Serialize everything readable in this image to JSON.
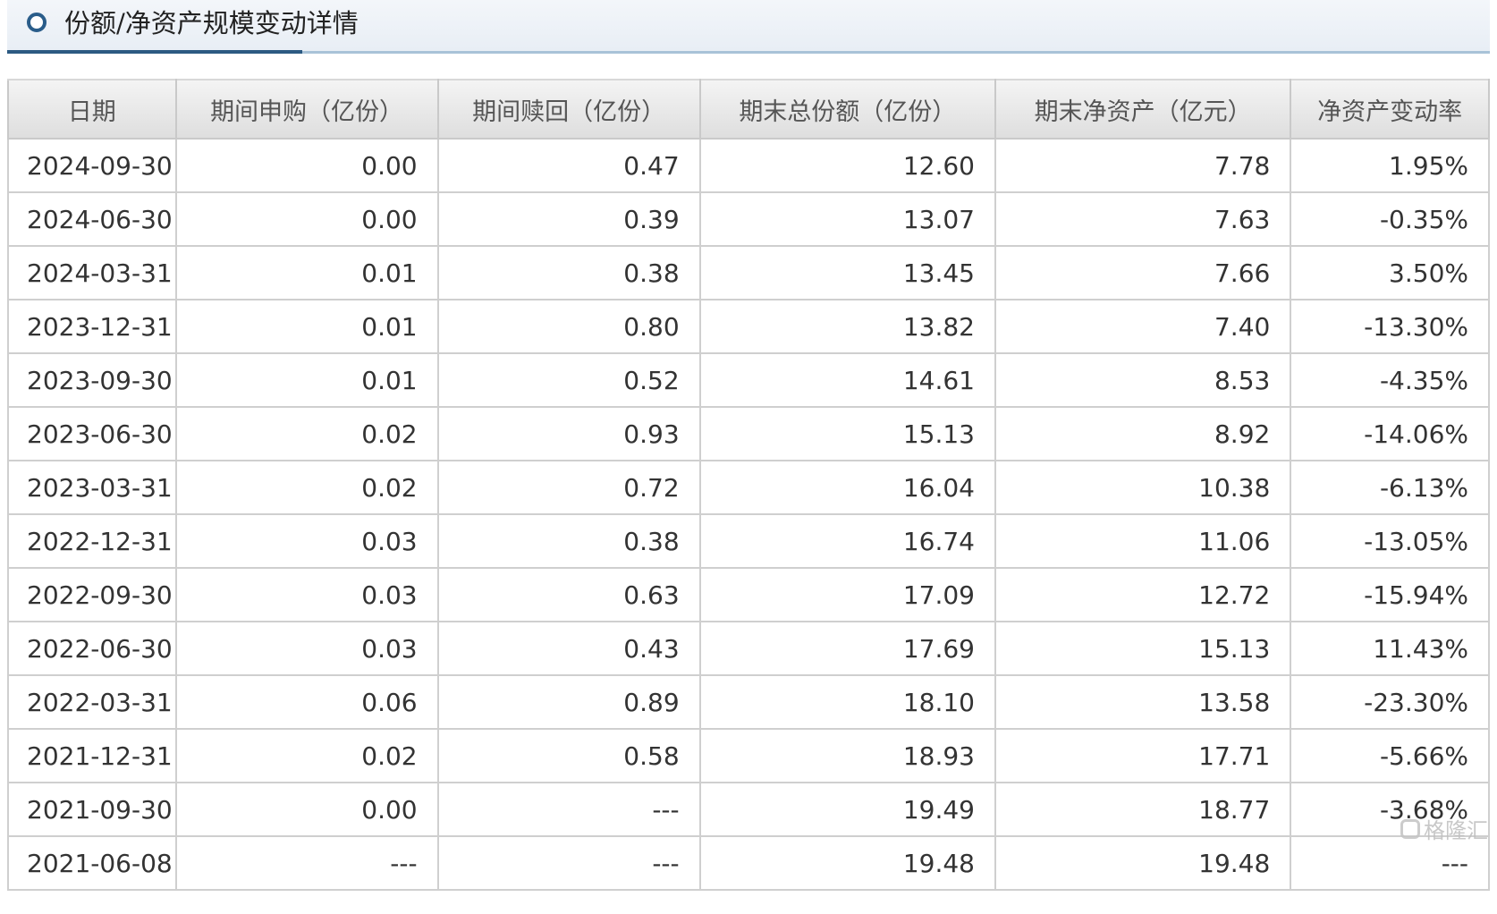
{
  "title": "份额/净资产规模变动详情",
  "colors": {
    "title_icon": "#2a5d8a",
    "title_accent": "#2c5a82",
    "header_bg": "#e6e6e6",
    "text": "#333333"
  },
  "table": {
    "headers": [
      "日期",
      "期间申购（亿份）",
      "期间赎回（亿份）",
      "期末总份额（亿份）",
      "期末净资产（亿元）",
      "净资产变动率"
    ],
    "rows": [
      [
        "2024-09-30",
        "0.00",
        "0.47",
        "12.60",
        "7.78",
        "1.95%"
      ],
      [
        "2024-06-30",
        "0.00",
        "0.39",
        "13.07",
        "7.63",
        "-0.35%"
      ],
      [
        "2024-03-31",
        "0.01",
        "0.38",
        "13.45",
        "7.66",
        "3.50%"
      ],
      [
        "2023-12-31",
        "0.01",
        "0.80",
        "13.82",
        "7.40",
        "-13.30%"
      ],
      [
        "2023-09-30",
        "0.01",
        "0.52",
        "14.61",
        "8.53",
        "-4.35%"
      ],
      [
        "2023-06-30",
        "0.02",
        "0.93",
        "15.13",
        "8.92",
        "-14.06%"
      ],
      [
        "2023-03-31",
        "0.02",
        "0.72",
        "16.04",
        "10.38",
        "-6.13%"
      ],
      [
        "2022-12-31",
        "0.03",
        "0.38",
        "16.74",
        "11.06",
        "-13.05%"
      ],
      [
        "2022-09-30",
        "0.03",
        "0.63",
        "17.09",
        "12.72",
        "-15.94%"
      ],
      [
        "2022-06-30",
        "0.03",
        "0.43",
        "17.69",
        "15.13",
        "11.43%"
      ],
      [
        "2022-03-31",
        "0.06",
        "0.89",
        "18.10",
        "13.58",
        "-23.30%"
      ],
      [
        "2021-12-31",
        "0.02",
        "0.58",
        "18.93",
        "17.71",
        "-5.66%"
      ],
      [
        "2021-09-30",
        "0.00",
        "---",
        "19.49",
        "18.77",
        "-3.68%"
      ],
      [
        "2021-06-08",
        "---",
        "---",
        "19.48",
        "19.48",
        "---"
      ]
    ]
  },
  "watermark": "格隆汇"
}
